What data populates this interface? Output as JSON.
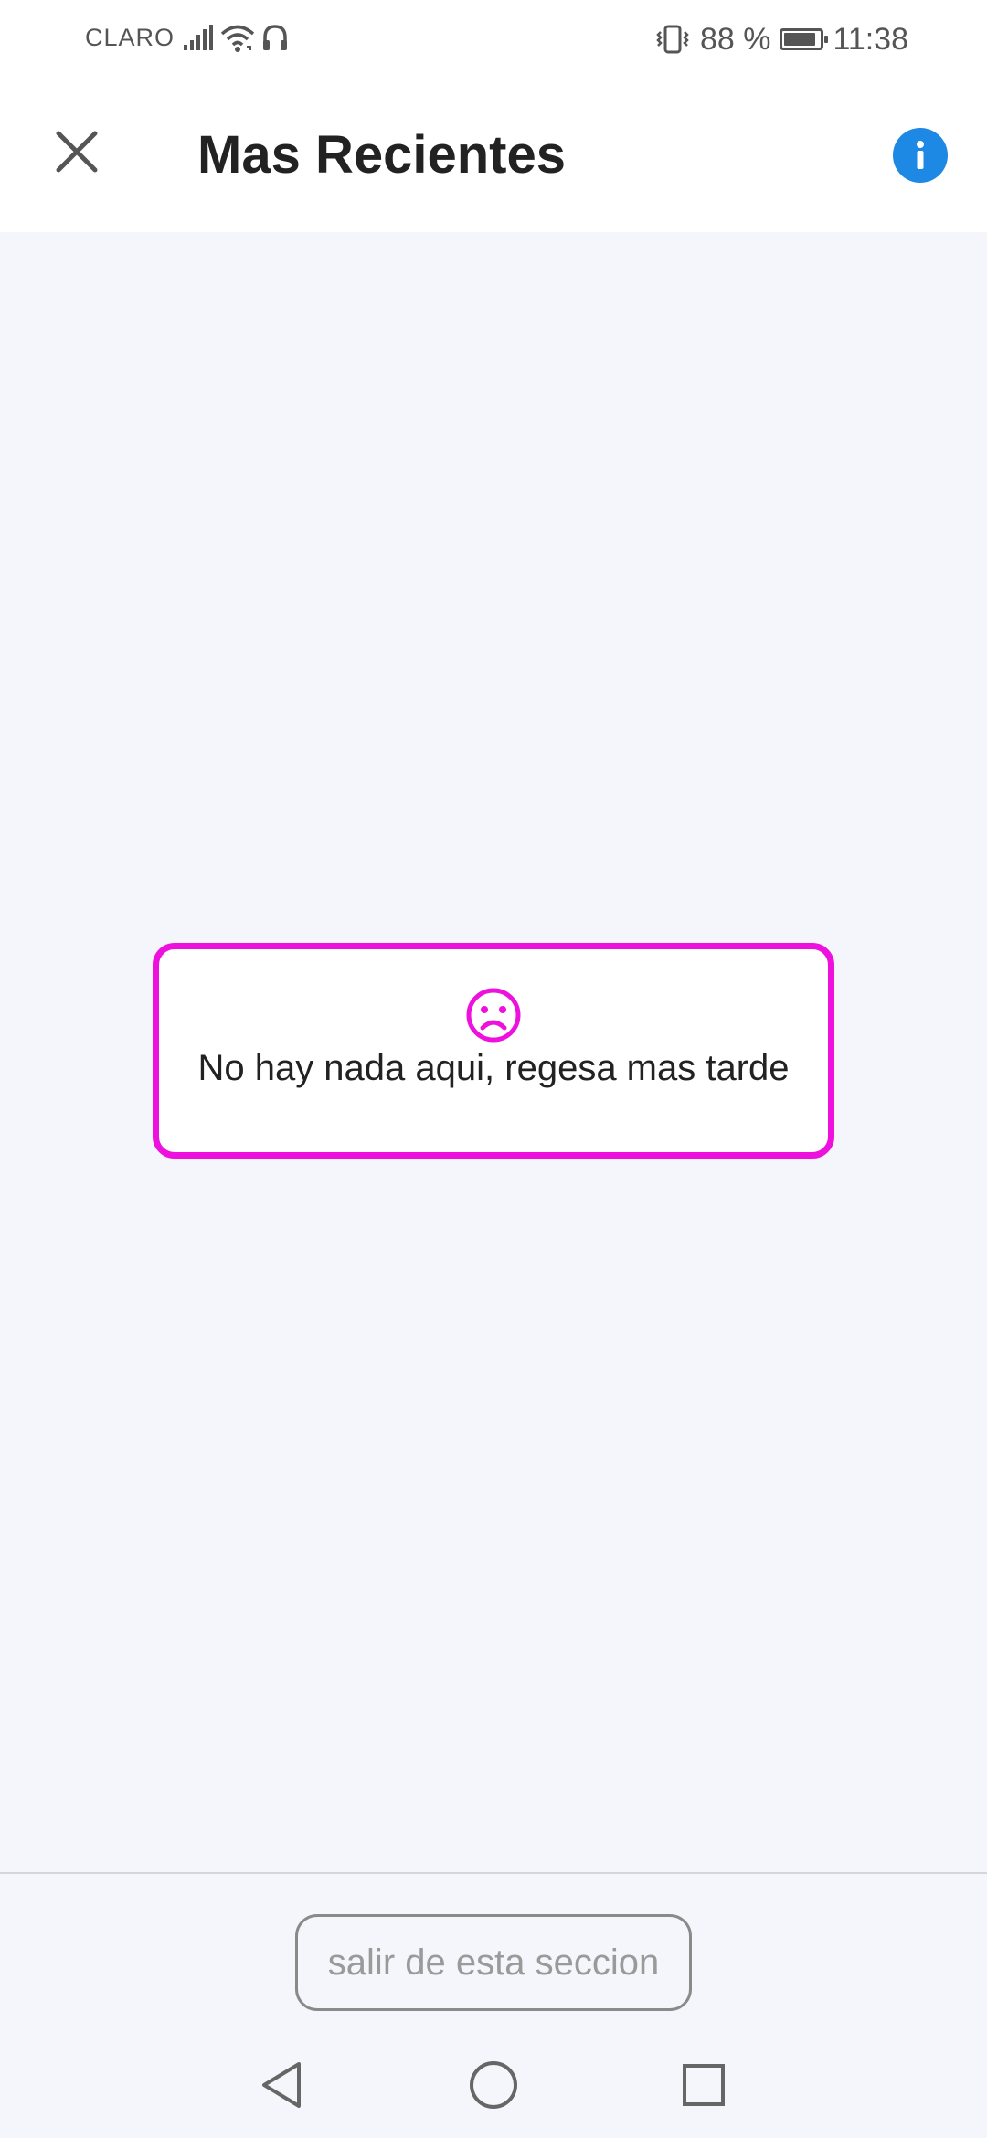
{
  "status_bar": {
    "carrier": "CLARO",
    "battery_percent_label": "88 %",
    "battery_level": 0.88,
    "time": "11:38",
    "icons": [
      "signal-icon",
      "wifi-icon",
      "headset-icon",
      "vibrate-icon",
      "battery-icon"
    ]
  },
  "header": {
    "title": "Mas Recientes",
    "close_icon": "close-icon",
    "info_icon": "info-icon",
    "info_color": "#1e88e5"
  },
  "empty_state": {
    "icon": "sad-face-icon",
    "message": "No hay nada aqui, regesa mas tarde",
    "border_color": "#ee11dd"
  },
  "footer": {
    "exit_label": "salir de esta seccion"
  },
  "nav_bar": {
    "icons": [
      "back-icon",
      "home-icon",
      "recents-icon"
    ]
  }
}
